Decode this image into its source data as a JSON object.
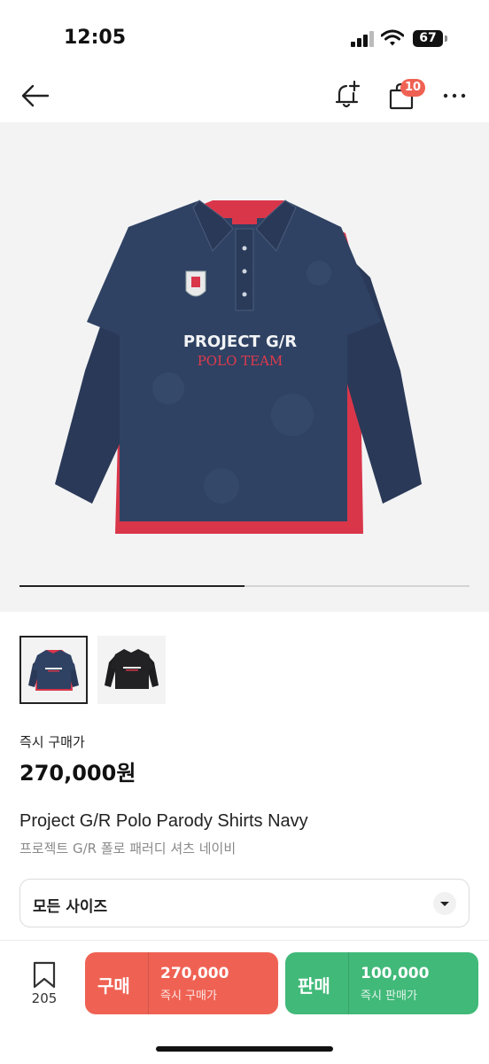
{
  "status_bar": {
    "time": "12:05",
    "battery": "67"
  },
  "nav": {
    "cart_badge": "10"
  },
  "gallery": {
    "progress": 0.5,
    "shirt_text_top": "PROJECT G/R",
    "shirt_text_bottom": "POLO TEAM"
  },
  "product": {
    "price_label": "즉시 구매가",
    "price": "270,000원",
    "title_en": "Project G/R Polo Parody Shirts Navy",
    "title_ko": "프로젝트 G/R 폴로 패러디 셔츠 네이비"
  },
  "size_selector": {
    "label": "모든 사이즈"
  },
  "bottom_bar": {
    "wish_count": "205",
    "buy": {
      "label": "구매",
      "price": "270,000",
      "sub": "즉시 구매가"
    },
    "sell": {
      "label": "판매",
      "price": "100,000",
      "sub": "즉시 판매가"
    }
  },
  "colors": {
    "buy": "#ef6253",
    "sell": "#41b979",
    "navy": "#2c3d5c",
    "red": "#d9364a"
  },
  "icons": [
    "back-arrow-icon",
    "bell-plus-icon",
    "shopping-bag-icon",
    "more-icon",
    "bookmark-icon",
    "chevron-down-icon"
  ]
}
